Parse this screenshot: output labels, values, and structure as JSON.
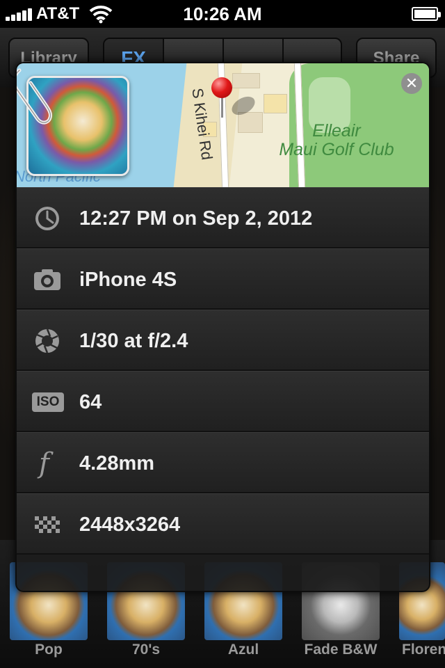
{
  "status_bar": {
    "carrier": "AT&T",
    "time": "10:26 AM"
  },
  "toolbar": {
    "library_label": "Library",
    "fx_label": "FX",
    "share_label": "Share"
  },
  "map": {
    "street_label": "S Kihei Rd",
    "golf_label_line1": "Elleair",
    "golf_label_line2": "Maui Golf Club",
    "sea_label": "North Pacific",
    "close_glyph": "✕"
  },
  "info_rows": [
    {
      "icon": "clock-icon",
      "value": "12:27 PM on Sep 2, 2012"
    },
    {
      "icon": "camera-icon",
      "value": "iPhone 4S"
    },
    {
      "icon": "aperture-icon",
      "value": "1/30 at f/2.4"
    },
    {
      "icon": "iso-icon",
      "icon_text": "ISO",
      "value": "64"
    },
    {
      "icon": "focal-length-icon",
      "icon_text": "f",
      "value": "4.28mm"
    },
    {
      "icon": "resolution-icon",
      "value": "2448x3264"
    }
  ],
  "filters": [
    {
      "label": "Pop"
    },
    {
      "label": "70's"
    },
    {
      "label": "Azul"
    },
    {
      "label": "Fade B&W"
    },
    {
      "label": "Florence"
    }
  ]
}
